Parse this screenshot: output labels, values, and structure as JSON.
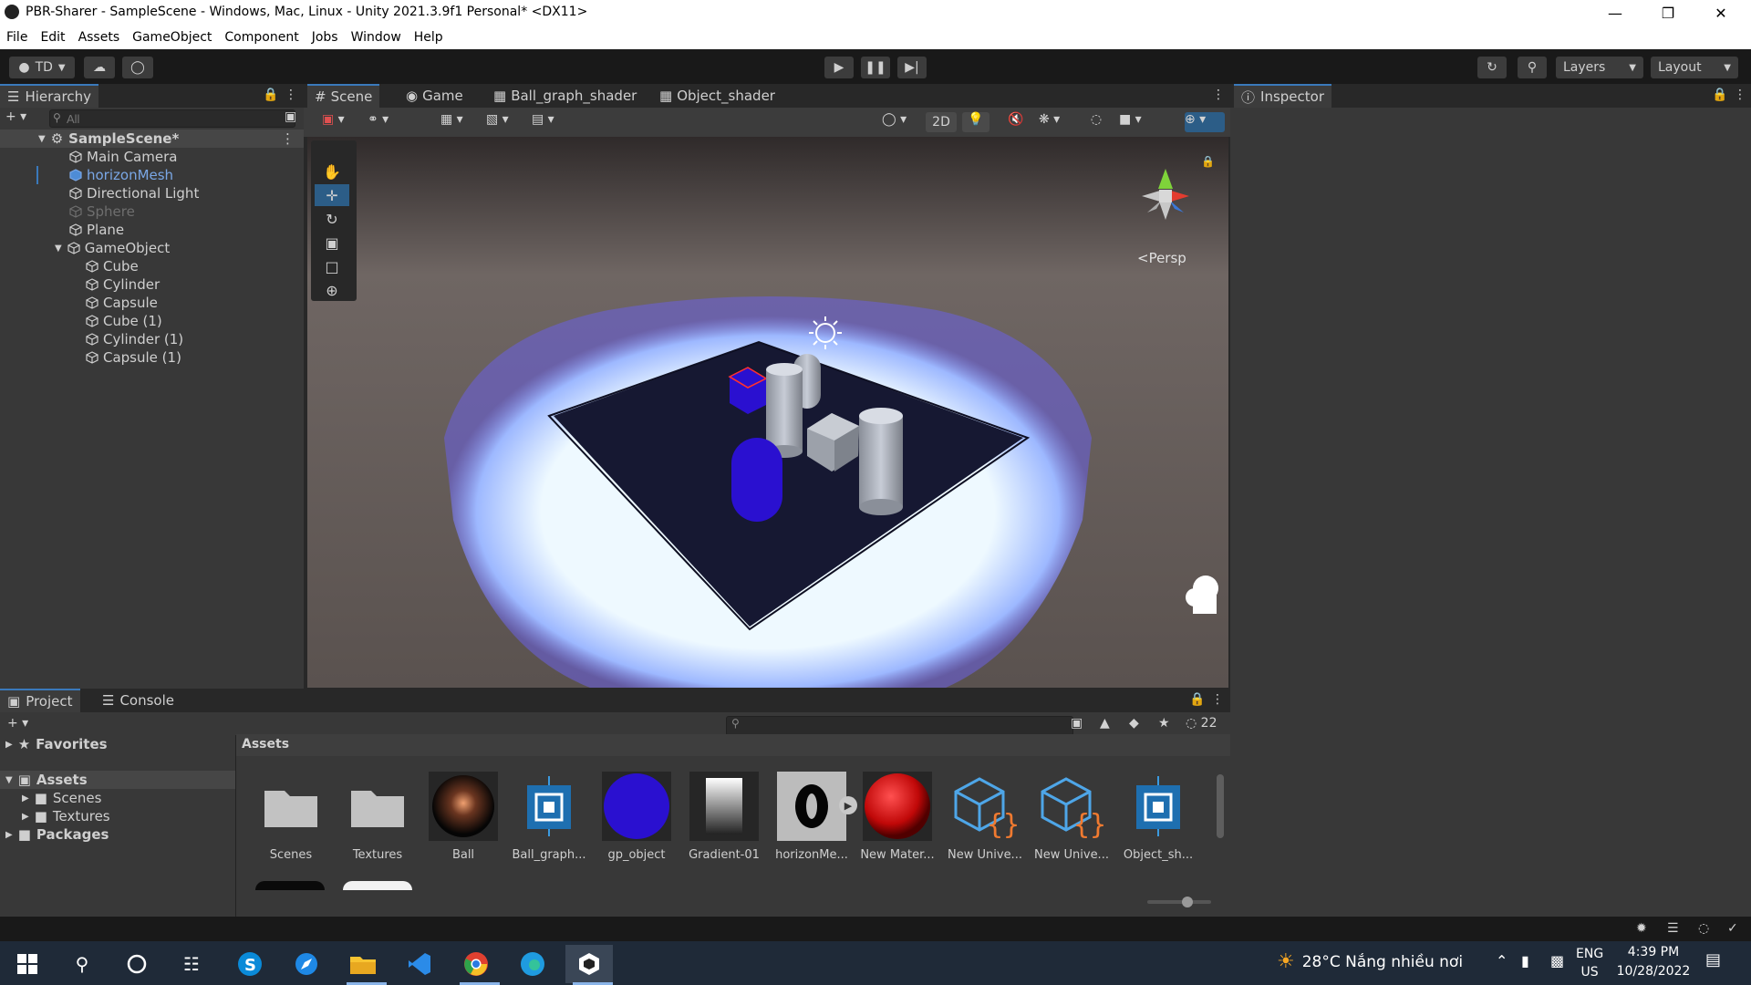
{
  "window": {
    "title": "PBR-Sharer - SampleScene - Windows, Mac, Linux - Unity 2021.3.9f1 Personal* <DX11>"
  },
  "menu": [
    "File",
    "Edit",
    "Assets",
    "GameObject",
    "Component",
    "Jobs",
    "Window",
    "Help"
  ],
  "toolbar": {
    "account": "TD",
    "layers": "Layers",
    "layout": "Layout"
  },
  "hierarchy": {
    "tab": "Hierarchy",
    "search_placeholder": "All",
    "scene": "SampleScene*",
    "items": [
      "Main Camera",
      "horizonMesh",
      "Directional Light",
      "Sphere",
      "Plane",
      "GameObject"
    ],
    "children": [
      "Cube",
      "Cylinder",
      "Capsule",
      "Cube (1)",
      "Cylinder (1)",
      "Capsule (1)"
    ]
  },
  "center_tabs": [
    "Scene",
    "Game",
    "Ball_graph_shader",
    "Object_shader"
  ],
  "scene": {
    "mode_2d": "2D",
    "persp": "<Persp"
  },
  "inspector": {
    "tab": "Inspector"
  },
  "bottom_tabs": [
    "Project",
    "Console"
  ],
  "project": {
    "favorites": "Favorites",
    "assets_root": "Assets",
    "folders": [
      "Scenes",
      "Textures"
    ],
    "packages": "Packages",
    "breadcrumb": "Assets",
    "hidden_count": "22",
    "assets": [
      "Scenes",
      "Textures",
      "Ball",
      "Ball_graph...",
      "gp_object",
      "Gradient-01",
      "horizonMe...",
      "New Mater...",
      "New Unive...",
      "New Unive...",
      "Object_sh..."
    ]
  },
  "taskbar": {
    "weather": "28°C  Nắng nhiều nơi",
    "lang": "ENG",
    "region": "US",
    "time": "4:39 PM",
    "date": "10/28/2022"
  },
  "colors": {
    "accent": "#3a79bb",
    "selected": "#2c5d87",
    "blue_obj": "#2a10d0",
    "red_mat": "#d81010"
  }
}
